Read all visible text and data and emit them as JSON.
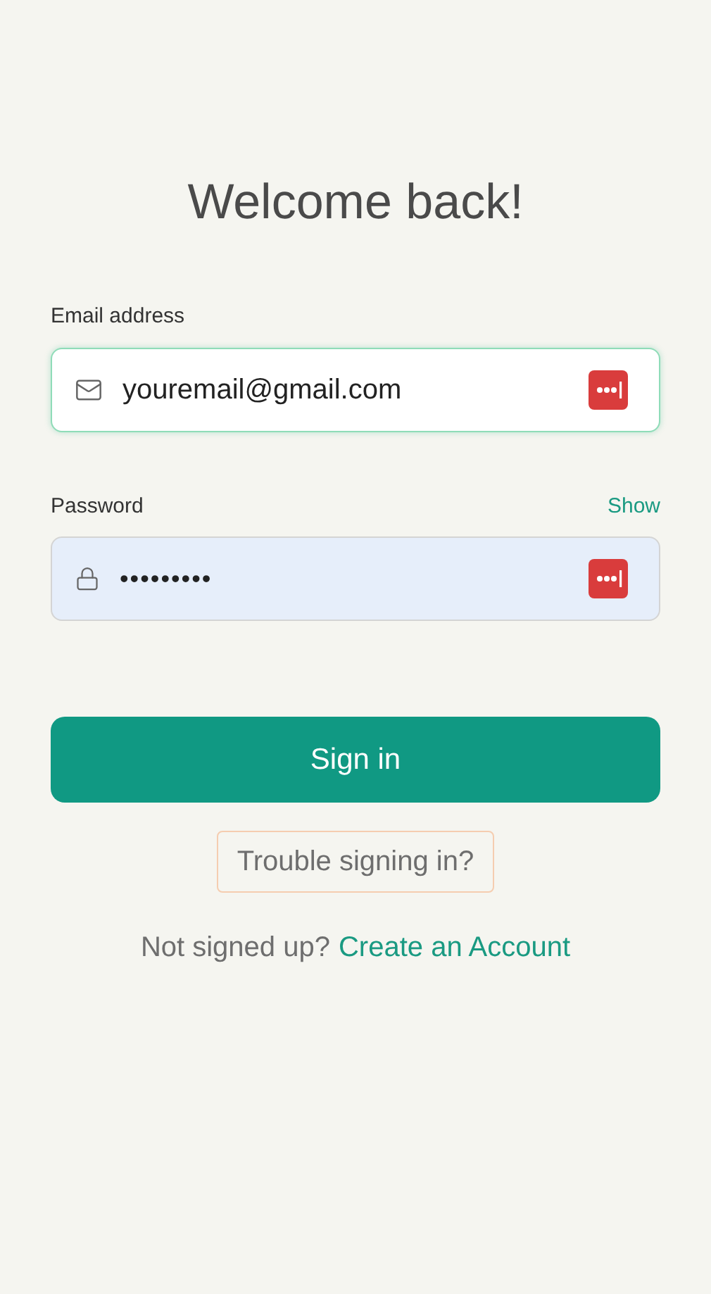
{
  "title": "Welcome back!",
  "fields": [
    {
      "kind": "email",
      "label": "Email address",
      "value": "youremail@gmail.com",
      "focused": true,
      "autofilled": false
    },
    {
      "kind": "password",
      "label": "Password",
      "value": "•••••••••",
      "focused": false,
      "autofilled": true,
      "action": "Show"
    }
  ],
  "submit": "Sign in",
  "trouble": "Trouble signing in?",
  "signup": {
    "prompt": "Not signed up?",
    "link": "Create an Account"
  }
}
